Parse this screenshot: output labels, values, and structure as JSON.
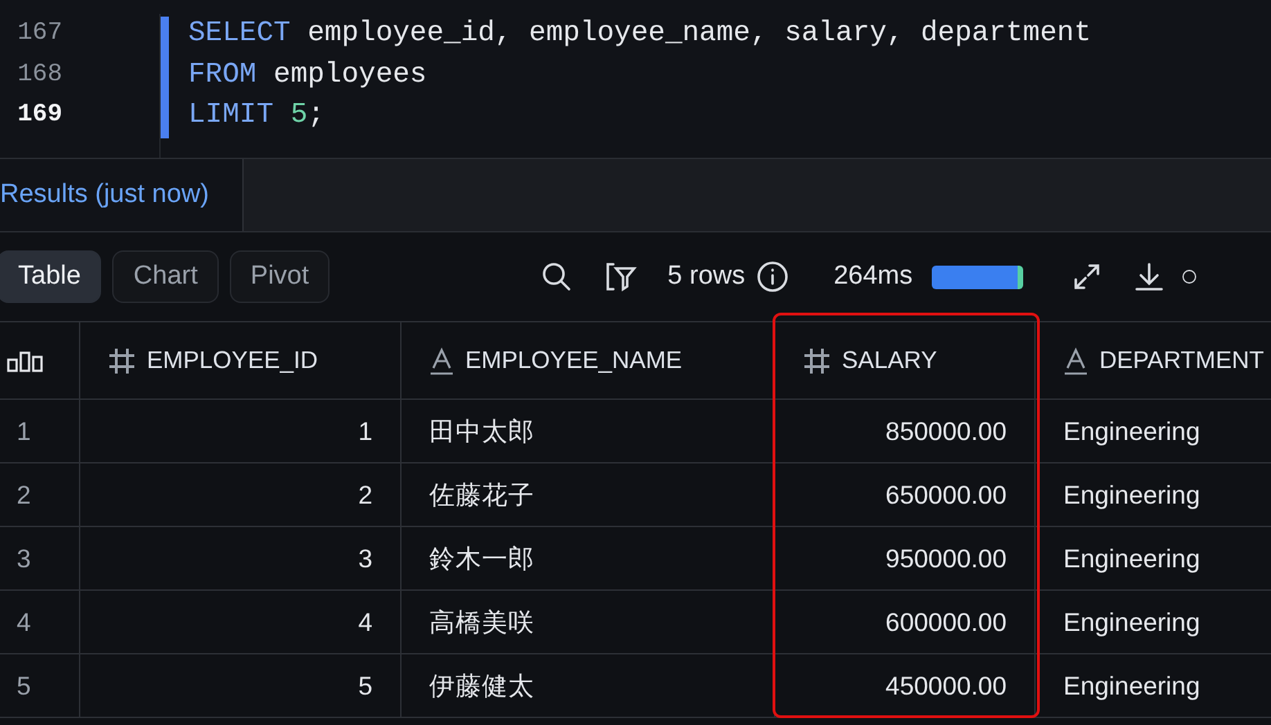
{
  "editor": {
    "lines": [
      {
        "number": "167",
        "current": false,
        "tokens": [
          {
            "kind": "keyword",
            "text": "SELECT"
          },
          {
            "kind": "plain",
            "text": "employee_id, employee_name, salary, department",
            "space_before": true
          }
        ]
      },
      {
        "number": "168",
        "current": false,
        "tokens": [
          {
            "kind": "keyword",
            "text": "FROM"
          },
          {
            "kind": "plain",
            "text": "employees",
            "space_before": true
          }
        ]
      },
      {
        "number": "169",
        "current": true,
        "tokens": [
          {
            "kind": "keyword",
            "text": "LIMIT"
          },
          {
            "kind": "number",
            "text": "5",
            "space_before": true
          },
          {
            "kind": "plain",
            "text": ";"
          }
        ]
      }
    ]
  },
  "results_tab": {
    "label": "Results (just now)"
  },
  "view_tabs": [
    {
      "label": "Table",
      "selected": true
    },
    {
      "label": "Chart",
      "selected": false
    },
    {
      "label": "Pivot",
      "selected": false
    }
  ],
  "toolbar": {
    "row_count": "5 rows",
    "duration": "264ms"
  },
  "table": {
    "columns": [
      {
        "label": "EMPLOYEE_ID",
        "kind": "number",
        "highlighted": false
      },
      {
        "label": "EMPLOYEE_NAME",
        "kind": "text",
        "highlighted": false
      },
      {
        "label": "SALARY",
        "kind": "number",
        "highlighted": true
      },
      {
        "label": "DEPARTMENT",
        "kind": "text",
        "highlighted": false
      }
    ],
    "rows": [
      {
        "index": "1",
        "cells": [
          "1",
          "田中太郎",
          "850000.00",
          "Engineering"
        ]
      },
      {
        "index": "2",
        "cells": [
          "2",
          "佐藤花子",
          "650000.00",
          "Engineering"
        ]
      },
      {
        "index": "3",
        "cells": [
          "3",
          "鈴木一郎",
          "950000.00",
          "Engineering"
        ]
      },
      {
        "index": "4",
        "cells": [
          "4",
          "高橋美咲",
          "600000.00",
          "Engineering"
        ]
      },
      {
        "index": "5",
        "cells": [
          "5",
          "伊藤健太",
          "450000.00",
          "Engineering"
        ]
      }
    ]
  }
}
